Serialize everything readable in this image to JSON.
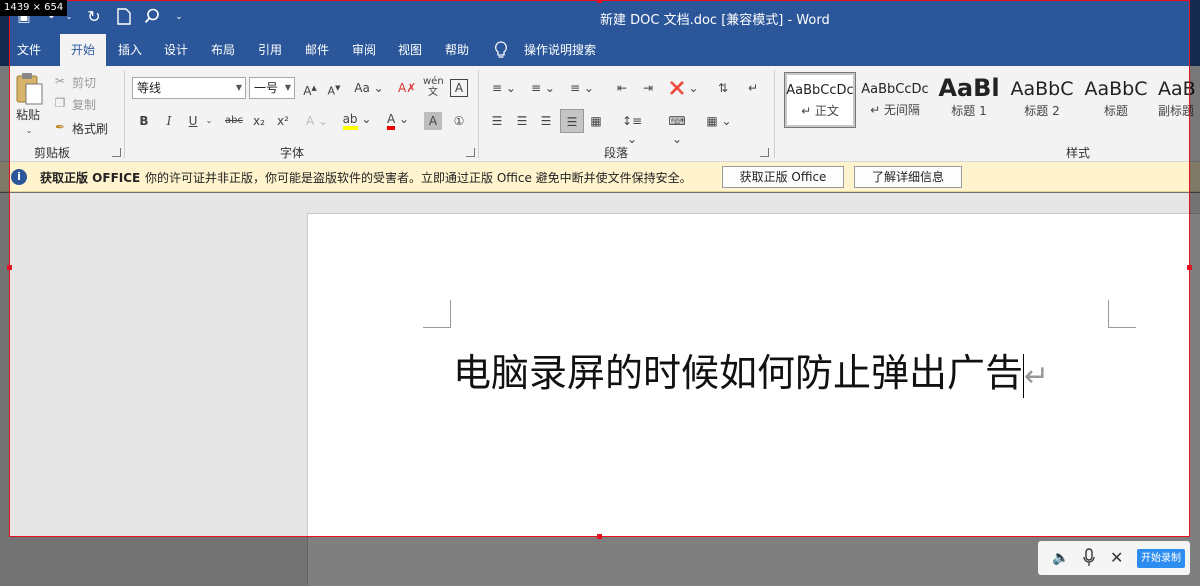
{
  "screen_size": "1439 × 654",
  "titlebar": {
    "title": "新建 DOC 文档.doc [兼容模式]  -  Word",
    "icons": [
      "save-icon",
      "undo-icon",
      "redo-icon",
      "new-doc-icon",
      "search-icon",
      "customize-qat-icon"
    ]
  },
  "tabs": [
    "文件",
    "开始",
    "插入",
    "设计",
    "布局",
    "引用",
    "邮件",
    "审阅",
    "视图",
    "帮助"
  ],
  "tell_me": "操作说明搜索",
  "clipboard": {
    "paste": "粘贴",
    "cut": "剪切",
    "copy": "复制",
    "format_painter": "格式刷",
    "group": "剪贴板"
  },
  "font": {
    "name": "等线",
    "size": "一号",
    "group": "字体",
    "buttons": [
      "B",
      "I",
      "U",
      "abc",
      "x₂",
      "x²"
    ]
  },
  "paragraph": {
    "group": "段落"
  },
  "styles": {
    "group": "样式",
    "items": [
      {
        "sample": "AaBbCcDc",
        "name": "↵ 正文"
      },
      {
        "sample": "AaBbCcDc",
        "name": "↵ 无间隔"
      },
      {
        "sample": "AaBl",
        "name": "标题 1"
      },
      {
        "sample": "AaBbC",
        "name": "标题 2"
      },
      {
        "sample": "AaBbC",
        "name": "标题"
      },
      {
        "sample": "AaB",
        "name": "副标题"
      }
    ]
  },
  "infobar": {
    "title": "获取正版 OFFICE",
    "message": "你的许可证并非正版，你可能是盗版软件的受害者。立即通过正版 Office 避免中断并使文件保持安全。",
    "btn_get": "获取正版 Office",
    "btn_learn": "了解详细信息"
  },
  "document": {
    "text": "电脑录屏的时候如何防止弹出广告"
  },
  "recorder": {
    "start": "开始录制"
  },
  "colors": {
    "word_blue": "#2b579a",
    "record_border": "#e81123",
    "infobar_bg": "#fff4ce",
    "record_button": "#2d8cf0"
  }
}
